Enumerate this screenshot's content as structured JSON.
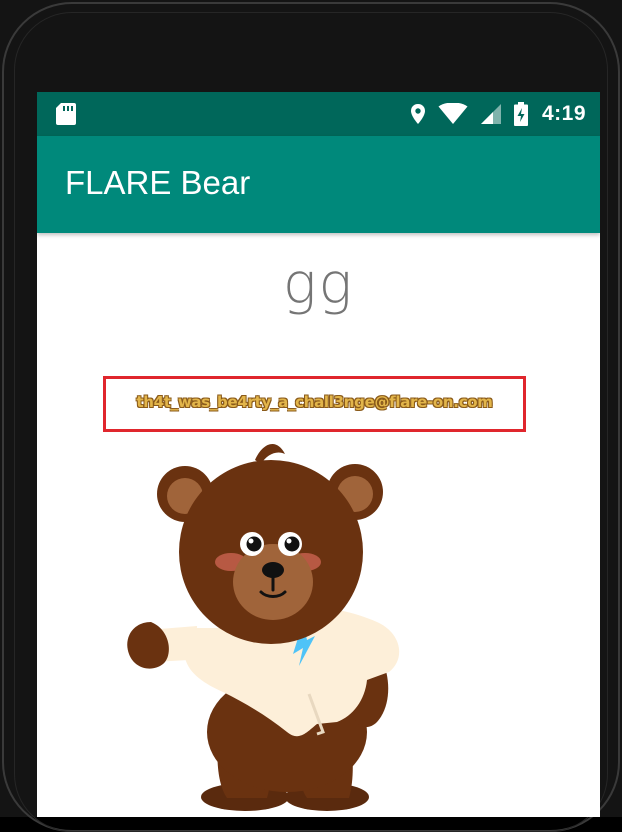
{
  "status_bar": {
    "time": "4:19",
    "icons": [
      "sd-card-icon",
      "location-icon",
      "wifi-icon",
      "signal-icon",
      "battery-charging-icon"
    ],
    "background": "#00675a"
  },
  "app_bar": {
    "title": "FLARE Bear",
    "background": "#00897b"
  },
  "content": {
    "result_text": "gg",
    "flag_text": "th4t_was_be4rty_a_chall3nge@flare-on.com",
    "highlight_color": "#e0262d"
  },
  "image": {
    "subject": "bear-icon",
    "shirt_logo": "flare-logo-icon"
  }
}
